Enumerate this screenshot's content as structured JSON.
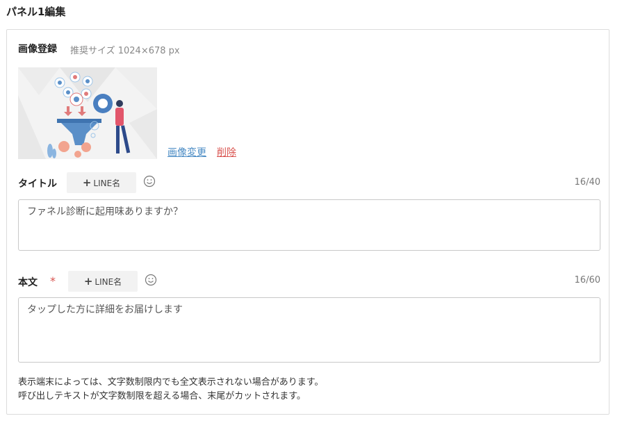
{
  "page": {
    "title": "パネル1編集"
  },
  "image_section": {
    "label": "画像登録",
    "hint": "推奨サイズ 1024×678 px",
    "change_label": "画像変更",
    "delete_label": "削除"
  },
  "title_field": {
    "label": "タイトル",
    "line_name_button": "LINE名",
    "value": "ファネル診断に起用味ありますか？",
    "counter": "16/40"
  },
  "body_field": {
    "label": "本文",
    "required_mark": "*",
    "line_name_button": "LINE名",
    "value": "タップした方に詳細をお届けします",
    "counter": "16/60"
  },
  "notes": {
    "line1": "表示端末によっては、文字数制限内でも全文表示されない場合があります。",
    "line2": "呼び出しテキストが文字数制限を超える場合、末尾がカットされます。"
  },
  "colors": {
    "link": "#4a8bc4",
    "delete": "#d9534f",
    "required": "#d9534f"
  }
}
